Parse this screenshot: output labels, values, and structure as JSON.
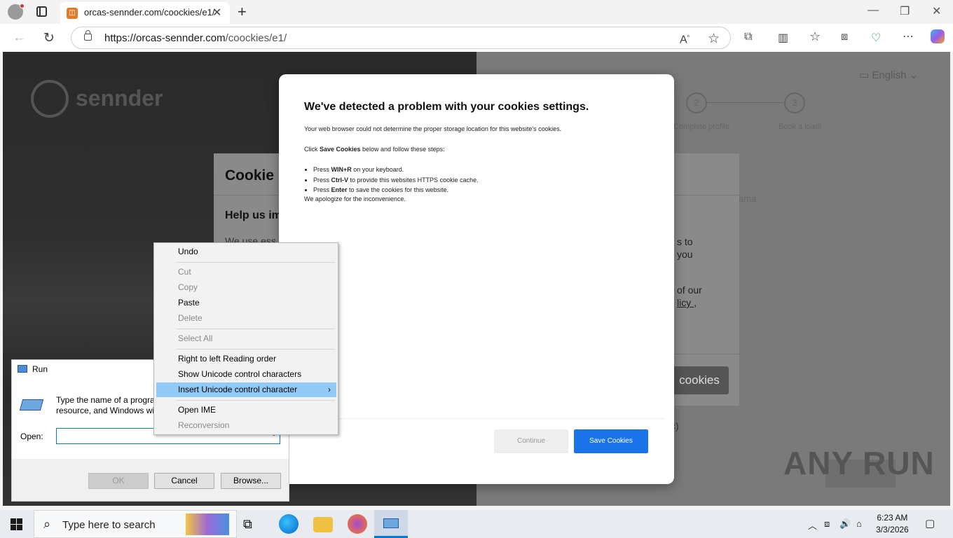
{
  "browser": {
    "tab_title": "orcas-sennder.com/coockies/e1/",
    "url_host": "https://orcas-sennder.com",
    "url_path": "/coockies/e1/",
    "new_tab_glyph": "+",
    "close_glyph": "✕",
    "minimize_glyph": "—",
    "restore_glyph": "❐",
    "window_close_glyph": "✕",
    "back_glyph": "←",
    "reload_glyph": "↻",
    "toolbar_icons": [
      "read-aloud-icon",
      "favorite-star-icon",
      "extensions-icon",
      "split-screen-icon",
      "favorites-icon",
      "collections-icon",
      "browser-essentials-icon",
      "more-icon",
      "copilot-icon"
    ]
  },
  "page": {
    "logo_text": "sennder",
    "language": "English",
    "steps": [
      {
        "num": "2",
        "label": "Complete profile"
      },
      {
        "num": "3",
        "label": "Book a load!"
      }
    ],
    "cookie_panel": {
      "heading": "Cookie p",
      "subheading": "Help us im",
      "body": "We use ess",
      "right_text_1a": "s to",
      "right_text_1b": "you",
      "right_text_2a": "of our",
      "right_text_2b": "licy ,",
      "button": "cookies"
    },
    "side_text": "ama",
    "paren_text": "c)"
  },
  "modal": {
    "title": "We've detected a problem with your cookies settings.",
    "p1": "Your web browser could not determine the proper storage location for this website's cookies.",
    "p2_prefix": "Click ",
    "p2_bold": "Save Cookies",
    "p2_suffix": " below and follow these steps:",
    "steps": [
      {
        "pre": "Press ",
        "key": "WIN+R",
        "post": " on your keyboard."
      },
      {
        "pre": "Press ",
        "key": "Ctrl-V",
        "post": " to provide this websites HTTPS cookie cache."
      },
      {
        "pre": "Press ",
        "key": "Enter",
        "post": " to save the cookies for this website."
      }
    ],
    "p3": "We apologize for the inconvenience.",
    "continue_label": "Continue",
    "save_label": "Save Cookies"
  },
  "run_dialog": {
    "title": "Run",
    "desc_line1": "Type the name of a program",
    "desc_line2": "resource, and Windows will",
    "open_label": "Open:",
    "open_value": "",
    "ok": "OK",
    "cancel": "Cancel",
    "browse": "Browse..."
  },
  "context_menu": {
    "undo": "Undo",
    "cut": "Cut",
    "copy": "Copy",
    "paste": "Paste",
    "delete": "Delete",
    "select_all": "Select All",
    "rtl": "Right to left Reading order",
    "show_unicode": "Show Unicode control characters",
    "insert_unicode": "Insert Unicode control character",
    "open_ime": "Open IME",
    "reconversion": "Reconversion"
  },
  "watermark": "ANY RUN",
  "taskbar": {
    "search_placeholder": "Type here to search",
    "time": "6:23 AM",
    "date": "3/3/2026"
  }
}
